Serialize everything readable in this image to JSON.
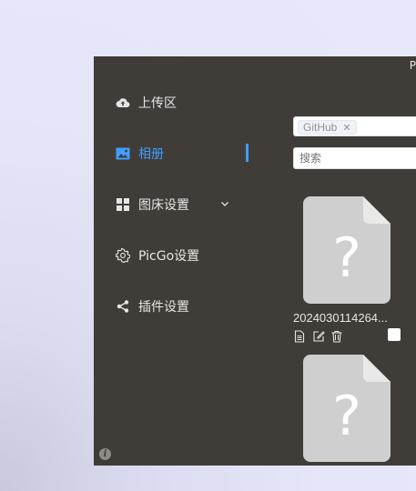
{
  "window": {
    "title_fragment": "P"
  },
  "sidebar": {
    "items": [
      {
        "label": "上传区",
        "icon": "cloud-upload-icon"
      },
      {
        "label": "相册",
        "icon": "image-icon",
        "active": true
      },
      {
        "label": "图床设置",
        "icon": "grid-icon",
        "has_submenu": true
      },
      {
        "label": "PicGo设置",
        "icon": "gear-icon"
      },
      {
        "label": "插件设置",
        "icon": "share-icon"
      }
    ],
    "info_icon": "i"
  },
  "gallery": {
    "filter_tag": "GitHub",
    "search": {
      "placeholder": "搜索"
    },
    "files": [
      {
        "name": "2024030114264...",
        "placeholder_glyph": "?"
      },
      {
        "name": "",
        "placeholder_glyph": "?"
      }
    ]
  },
  "colors": {
    "window_bg": "#403d38",
    "accent": "#409eff",
    "file_placeholder": "#cfcfcf"
  }
}
